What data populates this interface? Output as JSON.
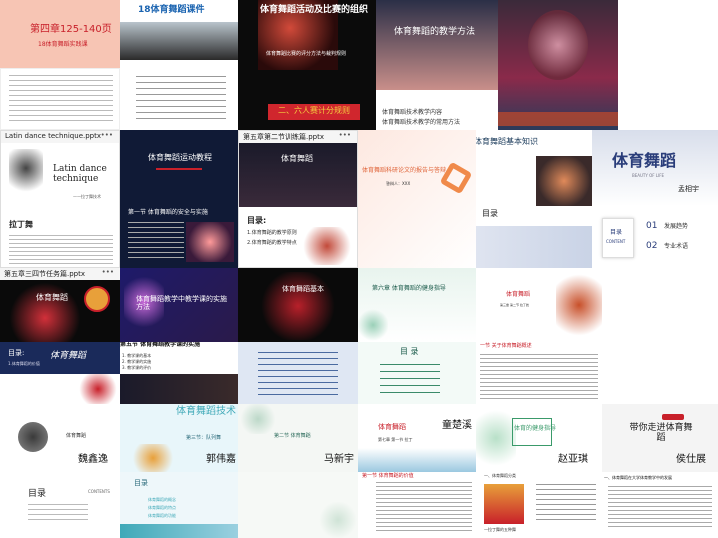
{
  "colors": {
    "pink": "#f6c8b8",
    "navy": "#0d1c3a",
    "red": "#c8202a",
    "teal": "#3fa9b8",
    "lavender": "#c9c6e6"
  },
  "row1": {
    "t1_title": "第四章125-140页",
    "t1_sub": "18体育舞蹈实践课",
    "t2_title": "18体育舞蹈课件",
    "t3_title": "体育舞蹈活动及比赛的组织",
    "t3_body": "体育舞蹈比赛的评分方法与裁判规则",
    "t3_red": "二、六人赛计分规则",
    "t4_title": "体育舞蹈的教学方法",
    "t4_b1": "体育舞蹈技术教学内容",
    "t4_b2": "体育舞蹈技术教学的常用方法"
  },
  "row2": {
    "t7_header": "Latin dance technique.pptx",
    "t7_title": "Latin dance technique",
    "t7_sub": "——拉丁舞技术",
    "t7_h2": "拉丁舞",
    "t8_title": "体育舞蹈运动教程",
    "t8_sec": "第一节 体育舞蹈的安全与实施",
    "t9_header": "第五章第二节训练篇.pptx",
    "t9_title": "体育舞蹈",
    "t9_menu": "目录:",
    "t9_i1": "1.体育舞蹈的教学原则",
    "t9_i2": "2.体育舞蹈的教学特点",
    "t10_title": "体育舞蹈科研论文的报告与答辩",
    "t10_sub": "答辩人：XXX",
    "t11_title": "体育舞蹈基本知识",
    "t11_h": "目录",
    "t12_title": "体育舞蹈",
    "t12_en": "BEAUTY OF LIFE",
    "t12_name": "孟相宇",
    "t12_c1": "目录",
    "t12_c2": "CONTENT",
    "t12_n1": "01",
    "t12_l1": "发展趋势",
    "t12_n2": "02",
    "t12_l2": "专业术语"
  },
  "row3": {
    "t13_header": "第五章三四节任务篇.pptx",
    "t13_title": "体育舞蹈",
    "t14_title": "体育舞蹈教学中教学课的实施方法",
    "t15_title": "体育舞蹈基本",
    "t16_sec": "第六章 体育舞蹈的健身指导",
    "t17_title": "体育舞蹈",
    "t17_sub": "第三章 第二节 拉丁舞"
  },
  "row4": {
    "t18_menu": "目录:",
    "t18_title": "体育舞蹈",
    "t18_i1": "1.体育舞蹈的价值",
    "t19_title": "第五节 体育舞蹈教学课的实施",
    "t19_i1": "1. 教学课的基本",
    "t19_i2": "2. 教学课的实施",
    "t19_i3": "3. 教学课的评价",
    "t21_h": "目 录",
    "t22_h": "一节 关于体育舞蹈概述"
  },
  "row5": {
    "t23_title": "体育舞蹈",
    "t23_name": "魏鑫逸",
    "t24_title": "体育舞蹈技术",
    "t24_sub": "第三节：队列舞",
    "t24_name": "郭伟嘉",
    "t25_title": "第二节 体育舞蹈",
    "t25_name": "马新宇",
    "t26_title": "体育舞蹈",
    "t26_name": "童楚溪",
    "t26_sub": "第七章 第一节 拉丁",
    "t27_title": "体育的健身指导",
    "t27_name": "赵亚琪",
    "t28_title": "带你走进体育舞蹈",
    "t28_name": "侯仕展"
  },
  "row6": {
    "t29_menu": "目录",
    "t29_en": "CONTENTS",
    "t30_h": "目录",
    "t30_i1": "体育舞蹈的概念",
    "t30_i2": "体育舞蹈的特点",
    "t30_i3": "体育舞蹈的功能",
    "t32_h": "第一节 体育舞蹈的价值",
    "t33_h": "一、体育舞蹈分类",
    "t33_sub": "一拉丁舞的五种舞",
    "t34_h": "一、体育舞蹈在大学体育教学中的发展"
  }
}
